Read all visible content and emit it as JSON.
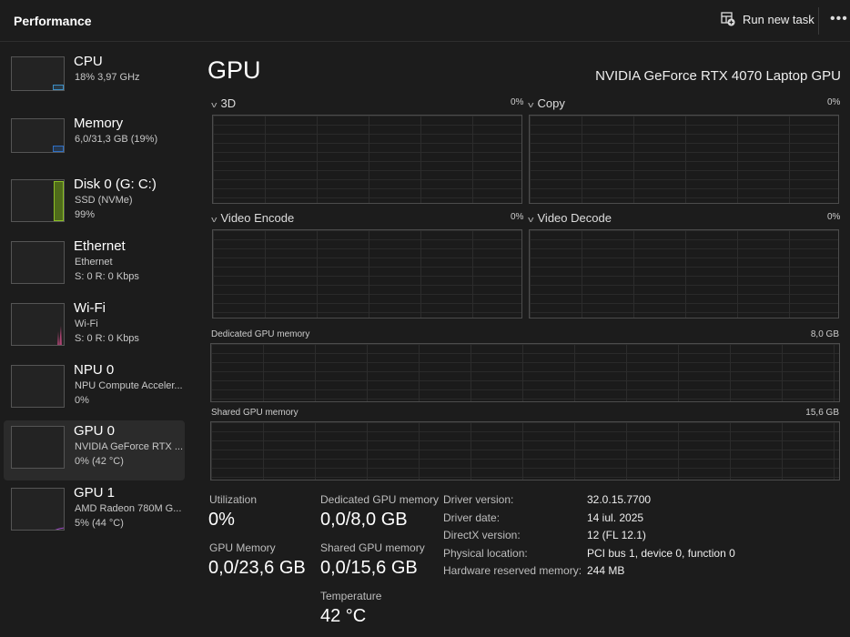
{
  "header": {
    "title": "Performance",
    "run_new_task": "Run new task",
    "more": "•••"
  },
  "sidebar": {
    "items": [
      {
        "name": "CPU",
        "line1": "18%  3,97 GHz",
        "line2": "",
        "color": "#3c8ec4"
      },
      {
        "name": "Memory",
        "line1": "6,0/31,3 GB (19%)",
        "line2": "",
        "color": "#2f6fc4"
      },
      {
        "name": "Disk 0 (G: C:)",
        "line1": "SSD (NVMe)",
        "line2": "99%",
        "color": "#8cbf26"
      },
      {
        "name": "Ethernet",
        "line1": "Ethernet",
        "line2": "S: 0  R: 0 Kbps",
        "color": "#a66"
      },
      {
        "name": "Wi-Fi",
        "line1": "Wi-Fi",
        "line2": "S: 0  R: 0 Kbps",
        "color": "#d04b86"
      },
      {
        "name": "NPU 0",
        "line1": "NPU Compute Acceler...",
        "line2": "0%",
        "color": "#2da8d8"
      },
      {
        "name": "GPU 0",
        "line1": "NVIDIA GeForce RTX ...",
        "line2": "0% (42 °C)",
        "color": "#a048c8",
        "selected": true
      },
      {
        "name": "GPU 1",
        "line1": "AMD Radeon 780M G...",
        "line2": "5% (44 °C)",
        "color": "#a048c8"
      }
    ]
  },
  "main": {
    "title": "GPU",
    "gpu_name": "NVIDIA GeForce RTX 4070 Laptop GPU",
    "engines": [
      {
        "label": "3D",
        "value": "0%"
      },
      {
        "label": "Copy",
        "value": "0%"
      },
      {
        "label": "Video Encode",
        "value": "0%"
      },
      {
        "label": "Video Decode",
        "value": "0%"
      }
    ],
    "dedicated": {
      "label": "Dedicated GPU memory",
      "max": "8,0 GB"
    },
    "shared": {
      "label": "Shared GPU memory",
      "max": "15,6 GB"
    },
    "stats": {
      "utilization_label": "Utilization",
      "utilization": "0%",
      "gpu_memory_label": "GPU Memory",
      "gpu_memory": "0,0/23,6 GB",
      "dedicated_label": "Dedicated GPU memory",
      "dedicated": "0,0/8,0 GB",
      "shared_label": "Shared GPU memory",
      "shared": "0,0/15,6 GB",
      "temperature_label": "Temperature",
      "temperature": "42 °C"
    },
    "details": [
      {
        "label": "Driver version:",
        "value": "32.0.15.7700"
      },
      {
        "label": "Driver date:",
        "value": "14 iul. 2025"
      },
      {
        "label": "DirectX version:",
        "value": "12 (FL 12.1)"
      },
      {
        "label": "Physical location:",
        "value": "PCI bus 1, device 0, function 0"
      },
      {
        "label": "Hardware reserved memory:",
        "value": "244 MB"
      }
    ]
  }
}
